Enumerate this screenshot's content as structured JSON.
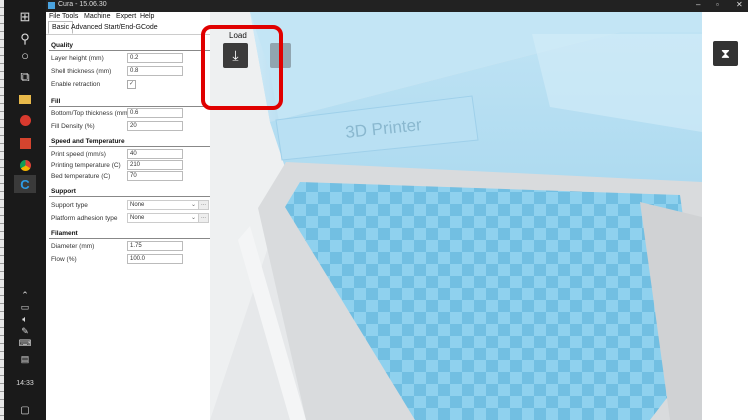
{
  "window": {
    "title": "Cura - 15.06.30",
    "minimize": "–",
    "maximize": "▫",
    "close": "✕"
  },
  "menu": [
    "File",
    "Tools",
    "Machine",
    "Expert",
    "Help"
  ],
  "tabs": [
    "Basic",
    "Advanced",
    "Start/End-GCode"
  ],
  "sections": {
    "quality": {
      "title": "Quality",
      "layer_height": {
        "label": "Layer height (mm)",
        "value": "0.2"
      },
      "shell_thickness": {
        "label": "Shell thickness (mm)",
        "value": "0.8"
      },
      "enable_retraction": {
        "label": "Enable retraction",
        "checked": true,
        "glyph": "✓",
        "more": "..."
      }
    },
    "fill": {
      "title": "Fill",
      "bottom_top_thickness": {
        "label": "Bottom/Top thickness (mm)",
        "value": "0.6"
      },
      "fill_density": {
        "label": "Fill Density (%)",
        "value": "20",
        "more": "..."
      }
    },
    "speed": {
      "title": "Speed and Temperature",
      "print_speed": {
        "label": "Print speed (mm/s)",
        "value": "40"
      },
      "printing_temperature": {
        "label": "Printing temperature (C)",
        "value": "210"
      },
      "bed_temperature": {
        "label": "Bed temperature (C)",
        "value": "70"
      }
    },
    "support": {
      "title": "Support",
      "support_type": {
        "label": "Support type",
        "value": "None",
        "more": "..."
      },
      "platform_adhesion": {
        "label": "Platform adhesion type",
        "value": "None",
        "more": "..."
      }
    },
    "filament": {
      "title": "Filament",
      "diameter": {
        "label": "Diameter (mm)",
        "value": "1.75"
      },
      "flow": {
        "label": "Flow (%)",
        "value": "100.0"
      }
    }
  },
  "viewport": {
    "load_label": "Load",
    "printer_label": "3D Printer"
  },
  "taskbar": {
    "clock": "14:33"
  },
  "colors": {
    "bed": "#8ed0ec",
    "bed_dark": "#6cb5d8",
    "highlight": "#e00000",
    "taskbar": "#1a1a1a"
  }
}
